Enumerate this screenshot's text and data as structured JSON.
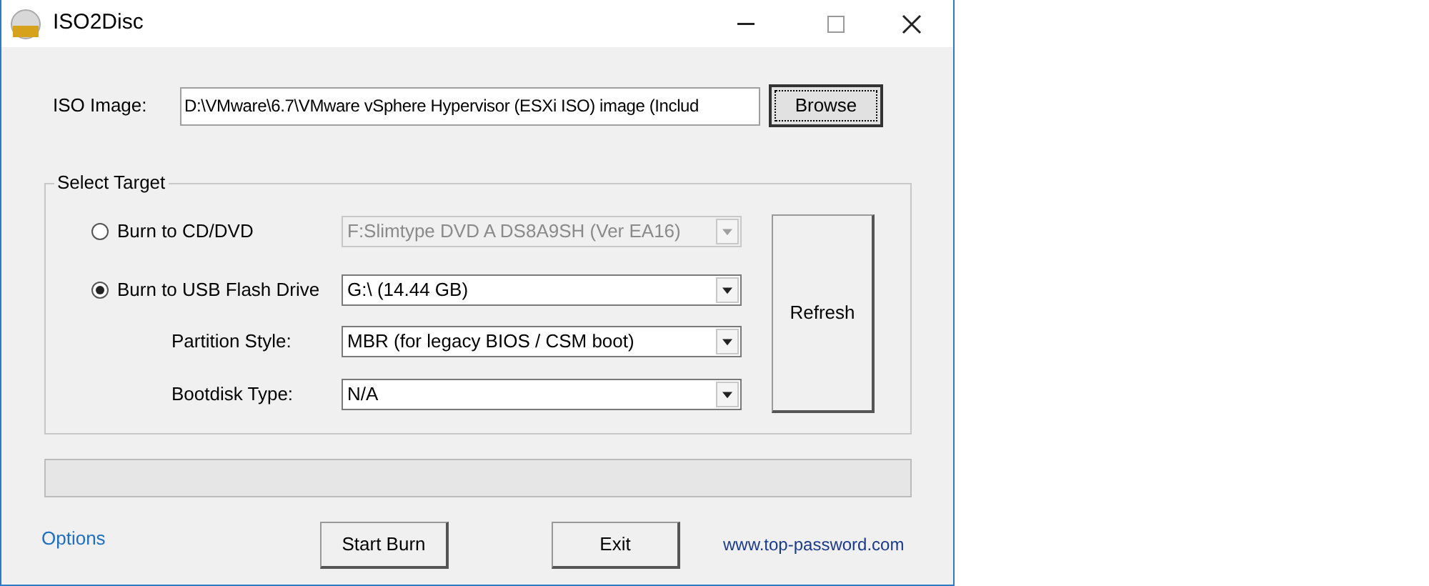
{
  "window": {
    "title": "ISO2Disc"
  },
  "iso_image": {
    "label": "ISO Image:",
    "value": "D:\\VMware\\6.7\\VMware vSphere Hypervisor (ESXi ISO) image (Includ",
    "browse": "Browse"
  },
  "select_target": {
    "title": "Select Target",
    "targets": [
      {
        "label": "Burn to CD/DVD",
        "selected": false,
        "value": "F:Slimtype DVD A  DS8A9SH (Ver EA16)",
        "disabled": true
      },
      {
        "label": "Burn to USB Flash Drive",
        "selected": true,
        "value": "G:\\ (14.44 GB)",
        "disabled": false
      }
    ],
    "options": [
      {
        "label": "Partition Style:",
        "value": "MBR (for legacy BIOS / CSM boot)"
      },
      {
        "label": "Bootdisk Type:",
        "value": "N/A"
      }
    ],
    "refresh": "Refresh"
  },
  "footer": {
    "options_link": "Options",
    "buttons": [
      "Start Burn",
      "Exit"
    ],
    "website_link": "www.top-password.com"
  }
}
